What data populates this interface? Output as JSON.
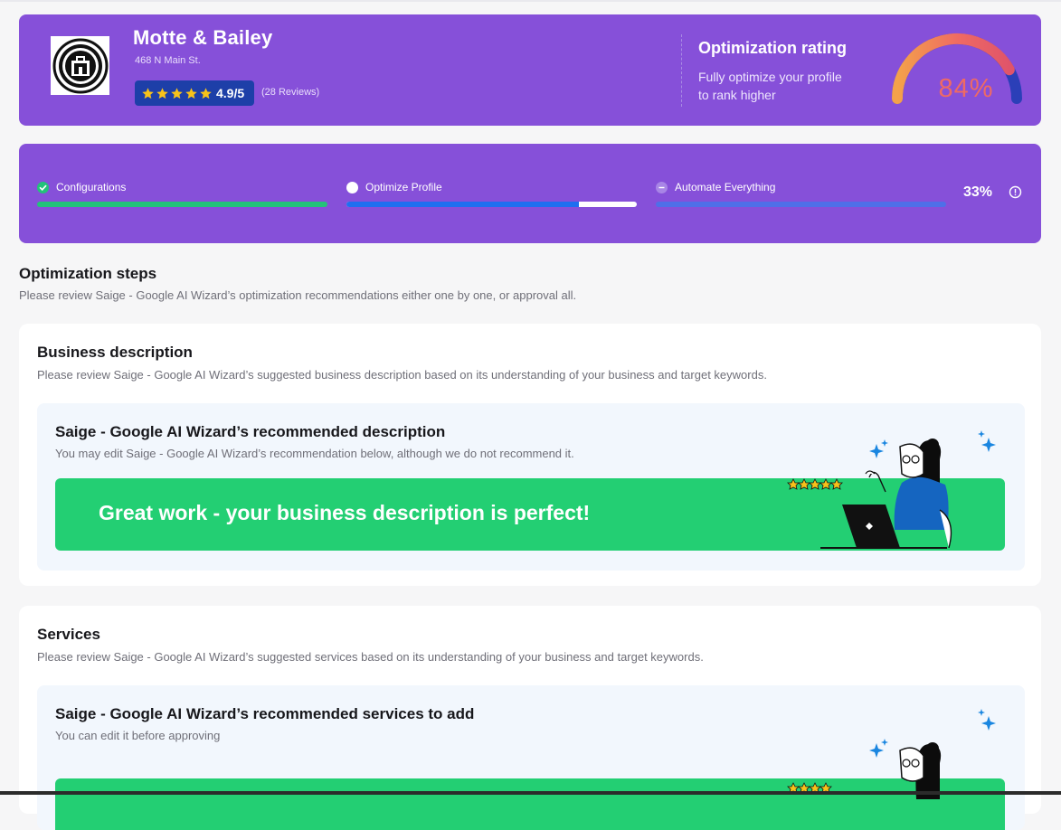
{
  "business": {
    "name": "Motte & Bailey",
    "address": "468 N Main St.",
    "rating": "4.9/5",
    "reviews": "(28 Reviews)",
    "star_color": "#f7c21a"
  },
  "optimization_rating": {
    "title": "Optimization rating",
    "subtitle": "Fully optimize your profile to rank higher",
    "value": "84%",
    "fraction": 0.84,
    "value_color": "#ef6a63"
  },
  "progress": {
    "steps": [
      {
        "label": "Configurations",
        "status": "complete",
        "fill_fraction": 1.0,
        "color": "#23c27a"
      },
      {
        "label": "Optimize Profile",
        "status": "in-progress",
        "fill_fraction": 0.8,
        "color": "#1f6ff0"
      },
      {
        "label": "Automate Everything",
        "status": "pending",
        "fill_fraction": 0.0,
        "color": "#4f6fe8"
      }
    ],
    "percent": "33%",
    "percent_value": 0.33
  },
  "section": {
    "title": "Optimization steps",
    "subtitle": "Please review Saige - Google AI Wizard’s optimization recommendations either one by one, or approval all."
  },
  "business_description": {
    "title": "Business description",
    "subtitle": "Please review Saige - Google AI Wizard’s suggested business description based on its understanding of your business and target keywords.",
    "inner_title": "Saige - Google AI Wizard’s recommended description",
    "inner_subtitle": "You may edit Saige - Google AI Wizard’s recommendation below, although we do not recommend it.",
    "banner_text": "Great work - your business description is perfect!"
  },
  "services": {
    "title": "Services",
    "subtitle": "Please review Saige - Google AI Wizard’s suggested services based on its understanding of your business and target keywords.",
    "inner_title": "Saige - Google AI Wizard’s recommended services to add",
    "inner_subtitle": "You can edit it before approving"
  },
  "colors": {
    "brand_purple": "#8650d9",
    "success_green": "#23cf73",
    "rating_pill": "#1d3fa8"
  },
  "icons": [
    "castle-logo-icon",
    "star-icon",
    "check-circle-icon",
    "info-icon",
    "sparkle-icon",
    "laptop-woman-illustration"
  ]
}
